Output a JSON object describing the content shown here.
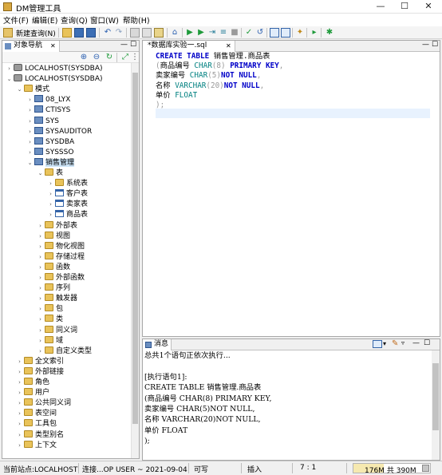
{
  "window": {
    "title": "DM管理工具",
    "minimize": "—",
    "maximize": "☐",
    "close": "✕"
  },
  "menu": [
    "文件(F)",
    "编辑(E)",
    "查询(Q)",
    "窗口(W)",
    "帮助(H)"
  ],
  "toolbar": {
    "new_query": "新建查询(N)"
  },
  "nav": {
    "tab": "对象导航",
    "tree": [
      {
        "label": "LOCALHOST(SYSDBA)",
        "depth": 0,
        "icon": "db",
        "exp": "›"
      },
      {
        "label": "LOCALHOST(SYSDBA)",
        "depth": 0,
        "icon": "db",
        "exp": "⌄"
      },
      {
        "label": "模式",
        "depth": 1,
        "icon": "folder",
        "exp": "⌄"
      },
      {
        "label": "08_LYX",
        "depth": 2,
        "icon": "schema",
        "exp": "›"
      },
      {
        "label": "CTISYS",
        "depth": 2,
        "icon": "schema",
        "exp": "›"
      },
      {
        "label": "SYS",
        "depth": 2,
        "icon": "schema",
        "exp": "›"
      },
      {
        "label": "SYSAUDITOR",
        "depth": 2,
        "icon": "schema",
        "exp": "›"
      },
      {
        "label": "SYSDBA",
        "depth": 2,
        "icon": "schema",
        "exp": "›"
      },
      {
        "label": "SYSSSO",
        "depth": 2,
        "icon": "schema",
        "exp": "›"
      },
      {
        "label": "销售管理",
        "depth": 2,
        "icon": "schema",
        "exp": "⌄",
        "selected": true
      },
      {
        "label": "表",
        "depth": 3,
        "icon": "folder",
        "exp": "⌄"
      },
      {
        "label": "系统表",
        "depth": 4,
        "icon": "folder",
        "exp": "›"
      },
      {
        "label": "客户表",
        "depth": 4,
        "icon": "table",
        "exp": "›"
      },
      {
        "label": "卖家表",
        "depth": 4,
        "icon": "table",
        "exp": "›"
      },
      {
        "label": "商品表",
        "depth": 4,
        "icon": "table",
        "exp": "›"
      },
      {
        "label": "外部表",
        "depth": 3,
        "icon": "folder",
        "exp": "›"
      },
      {
        "label": "视图",
        "depth": 3,
        "icon": "folder",
        "exp": "›"
      },
      {
        "label": "物化视图",
        "depth": 3,
        "icon": "folder",
        "exp": "›"
      },
      {
        "label": "存储过程",
        "depth": 3,
        "icon": "folder",
        "exp": "›"
      },
      {
        "label": "函数",
        "depth": 3,
        "icon": "folder",
        "exp": "›"
      },
      {
        "label": "外部函数",
        "depth": 3,
        "icon": "folder",
        "exp": "›"
      },
      {
        "label": "序列",
        "depth": 3,
        "icon": "folder",
        "exp": "›"
      },
      {
        "label": "触发器",
        "depth": 3,
        "icon": "folder",
        "exp": "›"
      },
      {
        "label": "包",
        "depth": 3,
        "icon": "folder",
        "exp": "›"
      },
      {
        "label": "类",
        "depth": 3,
        "icon": "folder",
        "exp": "›"
      },
      {
        "label": "同义词",
        "depth": 3,
        "icon": "folder",
        "exp": "›"
      },
      {
        "label": "域",
        "depth": 3,
        "icon": "folder",
        "exp": "›"
      },
      {
        "label": "自定义类型",
        "depth": 3,
        "icon": "folder",
        "exp": "›"
      },
      {
        "label": "全文索引",
        "depth": 1,
        "icon": "folder",
        "exp": "›"
      },
      {
        "label": "外部链接",
        "depth": 1,
        "icon": "folder",
        "exp": "›"
      },
      {
        "label": "角色",
        "depth": 1,
        "icon": "folder",
        "exp": "›"
      },
      {
        "label": "用户",
        "depth": 1,
        "icon": "folder",
        "exp": "›"
      },
      {
        "label": "公共同义词",
        "depth": 1,
        "icon": "folder",
        "exp": "›"
      },
      {
        "label": "表空间",
        "depth": 1,
        "icon": "folder",
        "exp": "›"
      },
      {
        "label": "工具包",
        "depth": 1,
        "icon": "folder",
        "exp": "›"
      },
      {
        "label": "类型别名",
        "depth": 1,
        "icon": "folder",
        "exp": "›"
      },
      {
        "label": "上下文",
        "depth": 1,
        "icon": "folder",
        "exp": "›"
      }
    ]
  },
  "editor": {
    "tab": "*数据库实验一.sql",
    "lines": [
      [
        [
          "kw",
          "CREATE TABLE "
        ],
        [
          "id",
          "销售管理.商品表"
        ]
      ],
      [
        [
          "pu",
          "("
        ],
        [
          "id",
          "商品编号 "
        ],
        [
          "ty",
          "CHAR"
        ],
        [
          "pu",
          "(8) "
        ],
        [
          "kw",
          "PRIMARY KEY"
        ],
        [
          "pu",
          ","
        ]
      ],
      [
        [
          "id",
          "卖家编号 "
        ],
        [
          "ty",
          "CHAR"
        ],
        [
          "pu",
          "(5)"
        ],
        [
          "kw",
          "NOT NULL"
        ],
        [
          "pu",
          ","
        ]
      ],
      [
        [
          "id",
          "名称 "
        ],
        [
          "ty",
          "VARCHAR"
        ],
        [
          "pu",
          "(20)"
        ],
        [
          "kw",
          "NOT NULL"
        ],
        [
          "pu",
          ","
        ]
      ],
      [
        [
          "id",
          "单价 "
        ],
        [
          "ty",
          "FLOAT"
        ]
      ],
      [
        [
          "pu",
          ");"
        ]
      ]
    ]
  },
  "messages": {
    "tab": "消息",
    "lines": [
      "总共1个语句正依次执行...",
      "",
      "[执行语句1]:",
      "CREATE TABLE 销售管理.商品表",
      "(商品编号 CHAR(8) PRIMARY KEY,",
      "卖家编号 CHAR(5)NOT NULL,",
      "名称 VARCHAR(20)NOT NULL,",
      "单价 FLOAT",
      ");"
    ]
  },
  "status": {
    "site": "当前站点:LOCALHOST",
    "connection": "连接...OP USER ~ 2021-09-04",
    "writable": "可写",
    "insert_mode": "插入",
    "position": "7 : 1",
    "memory_used": "176M",
    "memory_of": "共",
    "memory_total": "390M",
    "memory_fraction": 0.45
  }
}
